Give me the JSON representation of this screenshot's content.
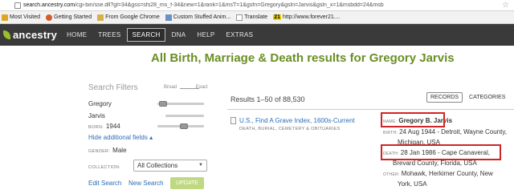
{
  "browser": {
    "url_host": "search.ancestry.com",
    "url_path": "/cgi-bin/sse.dll?gl=34&gss=sfs28_ms_f-34&new=1&rank=1&msT=1&gsfn=Gregory&gsln=Jarvis&gsln_x=1&msbdd=24&msb"
  },
  "bookmarks": [
    {
      "label": "Most Visited",
      "icon": "star-folder-icon",
      "color": "#e2a523"
    },
    {
      "label": "Getting Started",
      "icon": "firefox-icon",
      "color": "#d8592b"
    },
    {
      "label": "From Google Chrome",
      "icon": "folder-icon",
      "color": "#d7b24a"
    },
    {
      "label": "Custom Stuffed Anim...",
      "icon": "page-icon",
      "color": "#6b8fc7"
    },
    {
      "label": "Translate",
      "icon": "page-icon",
      "color": "#bbbbbb"
    },
    {
      "label": "http://www.forever21....",
      "icon": "forever21-icon",
      "color": "#f0d400",
      "badge": "21"
    }
  ],
  "nav": {
    "logo": "ancestry",
    "items": [
      "HOME",
      "TREES",
      "SEARCH",
      "DNA",
      "HELP",
      "EXTRAS"
    ],
    "active": "SEARCH"
  },
  "heading": "All Birth, Marriage & Death results for Gregory Jarvis",
  "filters": {
    "title": "Search Filters",
    "scale_left": "Broad",
    "scale_right": "Exact",
    "first_name": "Gregory",
    "last_name": "Jarvis",
    "born_label": "BORN:",
    "born_value": "1944",
    "hide_link": "Hide additional fields",
    "hide_arrow": "▴",
    "gender_label": "GENDER:",
    "gender_value": "Male",
    "collection_label": "COLLECTION:",
    "collection_value": "All Collections",
    "edit_search": "Edit Search",
    "new_search": "New Search",
    "update": "UPDATE"
  },
  "results": {
    "count_text": "Results 1–50 of 88,530",
    "records_btn": "RECORDS",
    "categories_btn": "CATEGORIES",
    "highlight_color": "#d12424",
    "record": {
      "title": "U.S., Find A Grave Index, 1600s-Current",
      "subtitle": "DEATH, BURIAL, CEMETERY & OBITUARIES",
      "name_label": "NAME:",
      "name_value": "Gregory B. Jarvis",
      "birth_label": "BIRTH:",
      "birth_line1": "24 Aug 1944 - Detroit, Wayne County,",
      "birth_line2": "Michigan, USA",
      "death_label": "DEATH:",
      "death_line1": "28 Jan 1986 - Cape Canaveral,",
      "death_line2": "Brevard County, Florida, USA",
      "other_label": "OTHER:",
      "other_line1": "Mohawk, Herkimer County, New",
      "other_line2": "York, USA"
    }
  }
}
